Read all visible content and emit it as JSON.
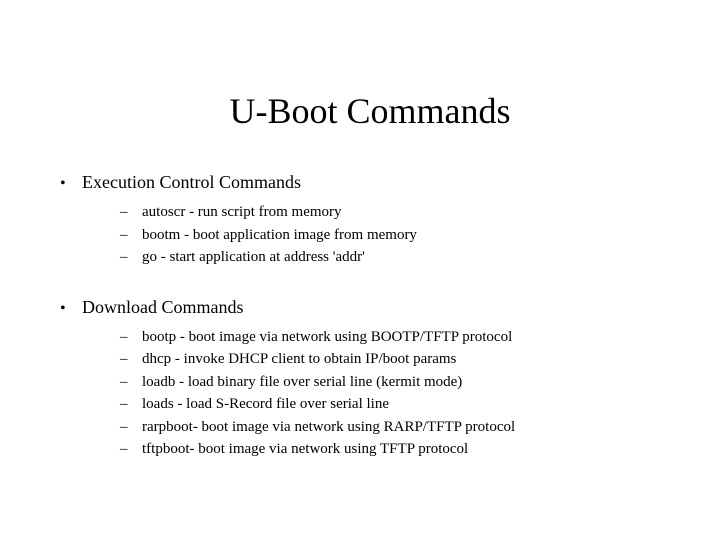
{
  "title": "U-Boot Commands",
  "sections": [
    {
      "heading": "Execution Control Commands",
      "items": [
        "autoscr - run script from memory",
        "bootm - boot application image from memory",
        "go - start application at address 'addr'"
      ]
    },
    {
      "heading": "Download Commands",
      "items": [
        "bootp - boot image via network using BOOTP/TFTP protocol",
        "dhcp - invoke DHCP client to obtain IP/boot params",
        "loadb - load binary file over serial line (kermit mode)",
        "loads - load S-Record file over serial line",
        "rarpboot- boot image via network using RARP/TFTP protocol",
        "tftpboot- boot image via network using TFTP protocol"
      ]
    }
  ],
  "bullets": {
    "section": "•",
    "sub": "–"
  }
}
